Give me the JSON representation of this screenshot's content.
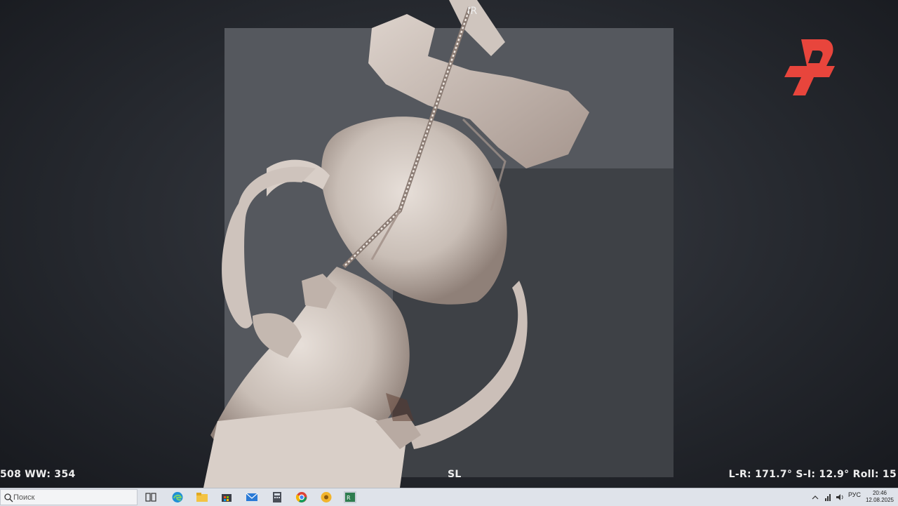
{
  "viewer": {
    "orientation_top": "IR",
    "orientation_bottom": "SL",
    "window_info": "508 WW: 354",
    "view_angles": "L-R: 171.7° S-I: 12.9° Roll: 15"
  },
  "channel_logo": {
    "icon": "ren-tv-logo-icon",
    "color": "#e8453c"
  },
  "taskbar": {
    "search_placeholder": "Поиск",
    "pinned_apps": [
      "task-view-icon",
      "edge-icon",
      "file-explorer-icon",
      "store-icon",
      "mail-icon",
      "calculator-icon",
      "chrome-icon",
      "app-icon",
      "radiant-viewer-icon"
    ],
    "tray": {
      "language": "РУС"
    },
    "clock": {
      "time": "20:46",
      "date": "12.08.2025"
    }
  }
}
